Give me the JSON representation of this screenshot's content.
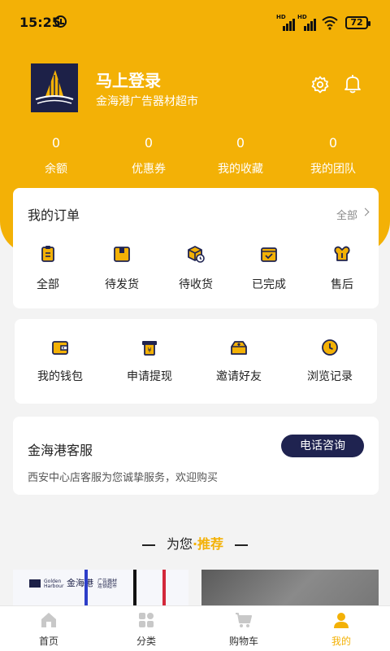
{
  "status_bar": {
    "time": "15:25",
    "network_1": "HD",
    "network_2": "HD",
    "battery": "72"
  },
  "profile": {
    "login_title": "马上登录",
    "store_name": "金海港广告器材超市"
  },
  "stats": [
    {
      "value": "0",
      "label": "余额"
    },
    {
      "value": "0",
      "label": "优惠券"
    },
    {
      "value": "0",
      "label": "我的收藏"
    },
    {
      "value": "0",
      "label": "我的团队"
    }
  ],
  "orders": {
    "title": "我的订单",
    "all_label": "全部",
    "items": [
      {
        "label": "全部",
        "icon": "clipboard-icon"
      },
      {
        "label": "待发货",
        "icon": "box-icon"
      },
      {
        "label": "待收货",
        "icon": "package-clock-icon"
      },
      {
        "label": "已完成",
        "icon": "calendar-check-icon"
      },
      {
        "label": "售后",
        "icon": "wrench-icon"
      }
    ]
  },
  "tools": [
    {
      "label": "我的钱包",
      "icon": "wallet-icon"
    },
    {
      "label": "申请提现",
      "icon": "cash-withdraw-icon"
    },
    {
      "label": "邀请好友",
      "icon": "invite-box-icon"
    },
    {
      "label": "浏览记录",
      "icon": "clock-icon"
    }
  ],
  "service": {
    "title": "金海港客服",
    "button": "电话咨询",
    "description": "西安中心店客服为您诚挚服务，欢迎购买"
  },
  "recommend": {
    "prefix": "为您",
    "dot": "·",
    "highlight": "推荐"
  },
  "product_banner": {
    "brand_en_1": "Golden",
    "brand_en_2": "Harbour",
    "brand_cn": "金海港",
    "tagline_1": "广告器材",
    "tagline_2": "连锁超市"
  },
  "tabs": [
    {
      "label": "首页",
      "icon": "home-icon"
    },
    {
      "label": "分类",
      "icon": "category-icon"
    },
    {
      "label": "购物车",
      "icon": "cart-icon"
    },
    {
      "label": "我的",
      "icon": "user-icon"
    }
  ],
  "colors": {
    "accent": "#f3b106",
    "navy": "#1f2350",
    "background": "#f3f3f3"
  }
}
